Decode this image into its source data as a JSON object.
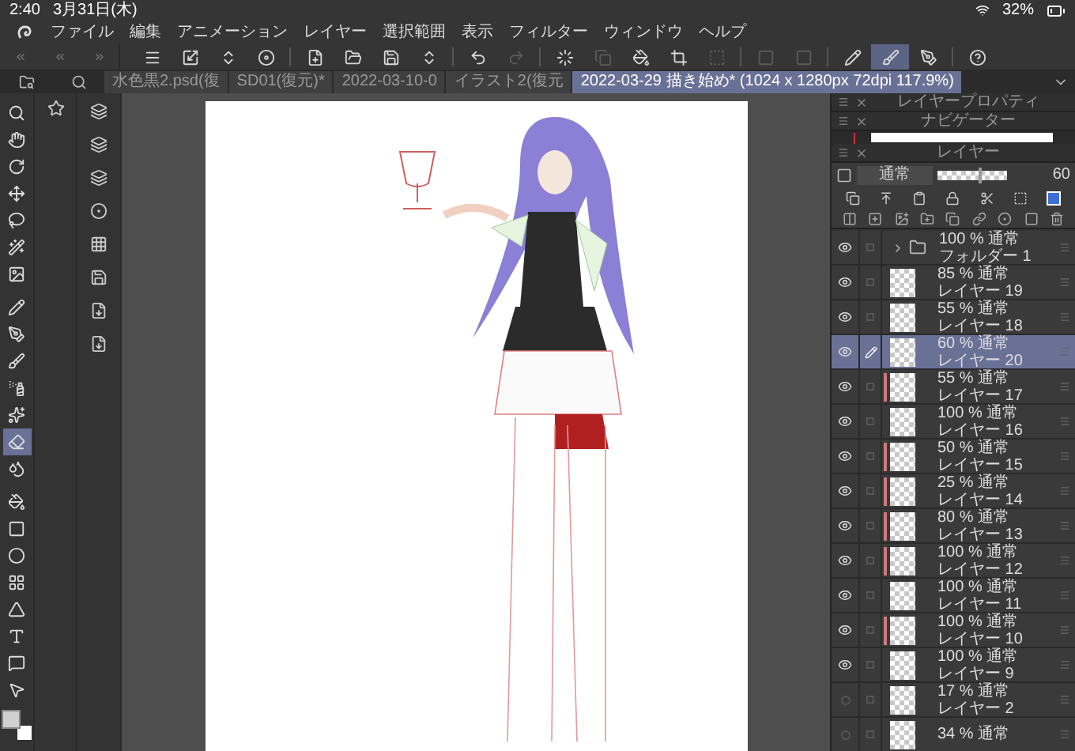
{
  "status_bar": {
    "time": "2:40",
    "date": "3月31日(木)",
    "battery": "32%"
  },
  "menu": [
    "ファイル",
    "編集",
    "アニメーション",
    "レイヤー",
    "選択範囲",
    "表示",
    "フィルター",
    "ウィンドウ",
    "ヘルプ"
  ],
  "toolbar": [
    {
      "selected": false,
      "disabled": false
    },
    {
      "selected": false,
      "disabled": false
    },
    {
      "selected": false,
      "disabled": false
    },
    {
      "selected": false,
      "disabled": false
    },
    {
      "selected": false,
      "disabled": false
    },
    {
      "selected": false,
      "disabled": false
    },
    {
      "selected": false,
      "disabled": false
    },
    {
      "selected": false,
      "disabled": false
    },
    {
      "selected": false,
      "disabled": false
    },
    {
      "selected": false,
      "disabled": true
    },
    {
      "selected": false,
      "disabled": false
    },
    {
      "selected": false,
      "disabled": true
    },
    {
      "selected": false,
      "disabled": false
    },
    {
      "selected": false,
      "disabled": false
    },
    {
      "selected": false,
      "disabled": true
    },
    {
      "selected": false,
      "disabled": true
    },
    {
      "selected": false,
      "disabled": true
    },
    {
      "selected": false,
      "disabled": false
    },
    {
      "selected": true,
      "disabled": false
    },
    {
      "selected": false,
      "disabled": false
    },
    {
      "selected": false,
      "disabled": false
    }
  ],
  "tabs": [
    {
      "label": "水色黒2.psd(復",
      "selected": false
    },
    {
      "label": "SD01(復元)*",
      "selected": false
    },
    {
      "label": "2022-03-10-0",
      "selected": false
    },
    {
      "label": "イラスト2(復元",
      "selected": false
    },
    {
      "label": "2022-03-29 描き始め* (1024 x 1280px 72dpi 117.9%)",
      "selected": true
    }
  ],
  "tools": [
    {
      "selected": false
    },
    {
      "selected": false
    },
    {
      "selected": false
    },
    {
      "selected": false
    },
    {
      "selected": false
    },
    {
      "selected": false
    },
    {
      "selected": false
    },
    {
      "selected": false
    },
    {
      "selected": false
    },
    {
      "selected": false
    },
    {
      "selected": false
    },
    {
      "selected": false
    },
    {
      "selected": true
    },
    {
      "selected": false
    },
    {
      "selected": false
    },
    {
      "selected": false
    },
    {
      "selected": false
    },
    {
      "selected": false
    },
    {
      "selected": false
    },
    {
      "selected": false
    },
    {
      "selected": false
    },
    {
      "selected": false
    }
  ],
  "panel_titles": [
    "レイヤープロパティ",
    "ナビゲーター",
    "レイヤー"
  ],
  "blend_mode": "通常",
  "opacity": {
    "level": 0.6,
    "value": "60"
  },
  "layers": [
    {
      "kind": "folder",
      "mode": "100 % 通常",
      "name": "フォルダー 1",
      "visible": true,
      "selected": false,
      "editing": false,
      "tagged": false
    },
    {
      "kind": "layer",
      "mode": "85 % 通常",
      "name": "レイヤー 19",
      "visible": true,
      "selected": false,
      "editing": false,
      "tagged": false
    },
    {
      "kind": "layer",
      "mode": "55 % 通常",
      "name": "レイヤー 18",
      "visible": true,
      "selected": false,
      "editing": false,
      "tagged": false
    },
    {
      "kind": "layer",
      "mode": "60 % 通常",
      "name": "レイヤー 20",
      "visible": true,
      "selected": true,
      "editing": true,
      "tagged": false
    },
    {
      "kind": "layer",
      "mode": "55 % 通常",
      "name": "レイヤー 17",
      "visible": true,
      "selected": false,
      "editing": false,
      "tagged": true
    },
    {
      "kind": "layer",
      "mode": "100 % 通常",
      "name": "レイヤー 16",
      "visible": true,
      "selected": false,
      "editing": false,
      "tagged": false
    },
    {
      "kind": "layer",
      "mode": "50 % 通常",
      "name": "レイヤー 15",
      "visible": true,
      "selected": false,
      "editing": false,
      "tagged": true
    },
    {
      "kind": "layer",
      "mode": "25 % 通常",
      "name": "レイヤー 14",
      "visible": true,
      "selected": false,
      "editing": false,
      "tagged": true
    },
    {
      "kind": "layer",
      "mode": "80 % 通常",
      "name": "レイヤー 13",
      "visible": true,
      "selected": false,
      "editing": false,
      "tagged": true
    },
    {
      "kind": "layer",
      "mode": "100 % 通常",
      "name": "レイヤー 12",
      "visible": true,
      "selected": false,
      "editing": false,
      "tagged": true
    },
    {
      "kind": "layer",
      "mode": "100 % 通常",
      "name": "レイヤー 11",
      "visible": true,
      "selected": false,
      "editing": false,
      "tagged": false
    },
    {
      "kind": "layer",
      "mode": "100 % 通常",
      "name": "レイヤー 10",
      "visible": true,
      "selected": false,
      "editing": false,
      "tagged": true
    },
    {
      "kind": "layer",
      "mode": "100 % 通常",
      "name": "レイヤー 9",
      "visible": true,
      "selected": false,
      "editing": false,
      "tagged": false
    },
    {
      "kind": "layer",
      "mode": "17 % 通常",
      "name": "レイヤー 2",
      "visible": false,
      "selected": false,
      "editing": false,
      "tagged": false
    },
    {
      "kind": "layer",
      "mode": "34 % 通常",
      "visible": false,
      "selected": false,
      "editing": false,
      "tagged": false
    }
  ]
}
